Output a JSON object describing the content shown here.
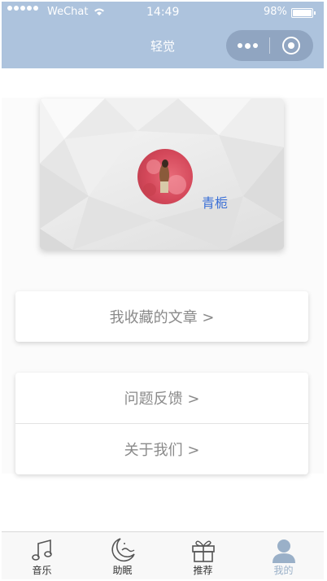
{
  "status_bar": {
    "carrier": "WeChat",
    "time": "14:49",
    "battery_percent": "98%",
    "battery_level": 0.98
  },
  "nav": {
    "title": "轻觉"
  },
  "profile": {
    "username": "青栀"
  },
  "menu": {
    "favorites": "我收藏的文章 >",
    "feedback": "问题反馈 >",
    "about": "关于我们 >"
  },
  "tabbar": {
    "items": [
      {
        "label": "音乐",
        "icon": "music-note-icon"
      },
      {
        "label": "助眠",
        "icon": "moon-icon"
      },
      {
        "label": "推荐",
        "icon": "gift-icon"
      },
      {
        "label": "我的",
        "icon": "user-icon",
        "active": true
      }
    ]
  },
  "colors": {
    "header": "#adc3dd",
    "username": "#3a6fd6",
    "tab_active": "#9ab0c8",
    "menu_text": "#8a8a8a"
  }
}
